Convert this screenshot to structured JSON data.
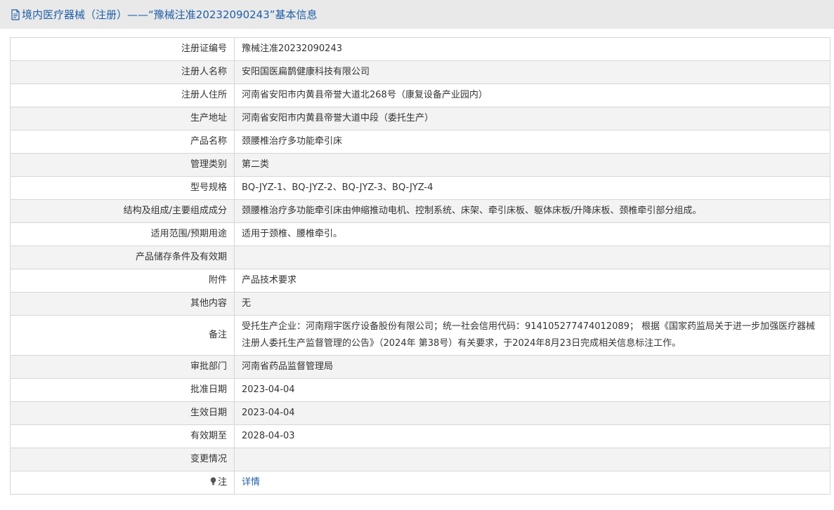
{
  "header": {
    "title": "境内医疗器械（注册）——“豫械注准20232090243”基本信息"
  },
  "rows": [
    {
      "label": "注册证编号",
      "value": "豫械注准20232090243"
    },
    {
      "label": "注册人名称",
      "value": "安阳国医扁鹊健康科技有限公司"
    },
    {
      "label": "注册人住所",
      "value": "河南省安阳市内黄县帝誉大道北268号（康复设备产业园内）"
    },
    {
      "label": "生产地址",
      "value": "河南省安阳市内黄县帝誉大道中段（委托生产）"
    },
    {
      "label": "产品名称",
      "value": "颈腰椎治疗多功能牵引床"
    },
    {
      "label": "管理类别",
      "value": "第二类"
    },
    {
      "label": "型号规格",
      "value": "BQ-JYZ-1、BQ-JYZ-2、BQ-JYZ-3、BQ-JYZ-4"
    },
    {
      "label": "结构及组成/主要组成成分",
      "value": "颈腰椎治疗多功能牵引床由伸缩推动电机、控制系统、床架、牵引床板、躯体床板/升降床板、颈椎牵引部分组成。"
    },
    {
      "label": "适用范围/预期用途",
      "value": "适用于颈椎、腰椎牵引。"
    },
    {
      "label": "产品储存条件及有效期",
      "value": ""
    },
    {
      "label": "附件",
      "value": "产品技术要求"
    },
    {
      "label": "其他内容",
      "value": "无"
    },
    {
      "label": "备注",
      "value": "受托生产企业：河南翔宇医疗设备股份有限公司；统一社会信用代码：914105277474012089； 根据《国家药监局关于进一步加强医疗器械注册人委托生产监督管理的公告》（2024年 第38号）有关要求，于2024年8月23日完成相关信息标注工作。"
    },
    {
      "label": "审批部门",
      "value": "河南省药品监督管理局"
    },
    {
      "label": "批准日期",
      "value": "2023-04-04"
    },
    {
      "label": "生效日期",
      "value": "2023-04-04"
    },
    {
      "label": "有效期至",
      "value": "2028-04-03"
    },
    {
      "label": "变更情况",
      "value": ""
    }
  ],
  "note_row": {
    "label": "注",
    "link_text": "详情"
  },
  "colors": {
    "title_bg": "#e9e9e9",
    "title_text": "#1f5fa8",
    "row_alt_bg": "#f3f3f3",
    "border": "#d6d6d6",
    "link": "#1f5fa8"
  },
  "icons": {
    "title": "document-icon",
    "note": "lightbulb-icon"
  }
}
